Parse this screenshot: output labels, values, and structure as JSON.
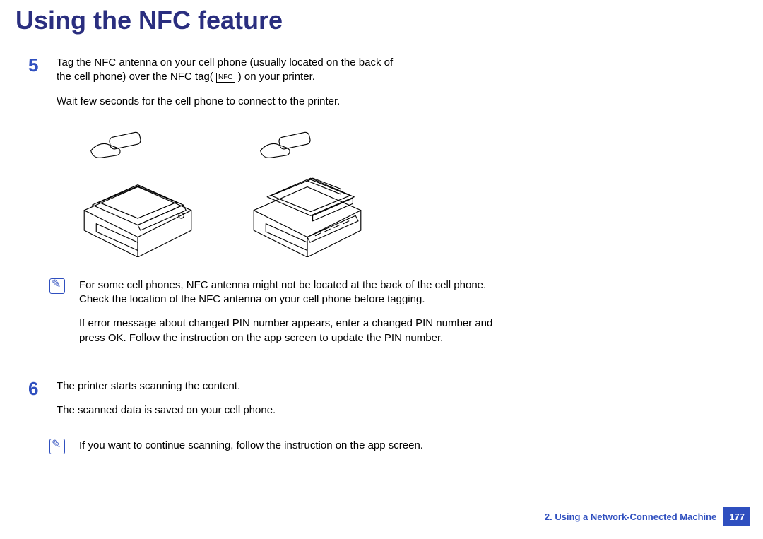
{
  "page": {
    "title": "Using the NFC feature"
  },
  "steps": {
    "s5": {
      "number": "5",
      "line1a": "Tag the NFC antenna on your cell phone (usually located on the back of",
      "line1b": "the cell phone) over the NFC tag(",
      "nfc_label": "NFC",
      "line1c": " ) on your printer.",
      "line2": "Wait few seconds for the cell phone to connect to the printer."
    },
    "s6": {
      "number": "6",
      "line1": "The printer starts scanning the content.",
      "line2": "The scanned data is saved on your cell phone."
    }
  },
  "notes": {
    "n1": {
      "p1": "For some cell phones, NFC antenna might not be located at the back of the cell phone. Check the location of the NFC antenna on your cell phone before tagging.",
      "p2": "If error message about changed PIN number appears, enter a changed PIN number and press OK. Follow the instruction on the app screen to update the PIN number."
    },
    "n2": {
      "p1": "If you want to continue scanning, follow the instruction on the app screen."
    }
  },
  "footer": {
    "chapter": "2.  Using a Network-Connected Machine",
    "page": "177"
  }
}
